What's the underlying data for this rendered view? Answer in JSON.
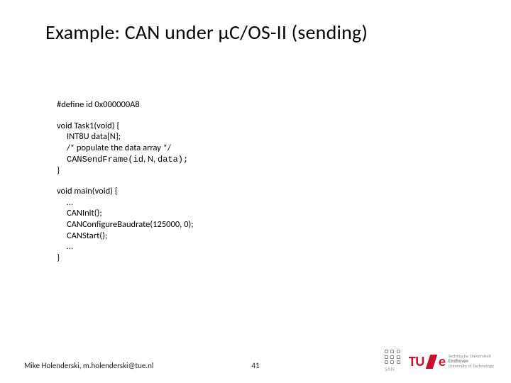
{
  "title": "Example: CAN under μC/OS-II (sending)",
  "code": {
    "define": "#define id 0x000000A8",
    "task": {
      "l1": "void Task1(void) {",
      "l2": "INT8U data[N];",
      "l3": "/* populate the data array */",
      "l4a": "CANSendFrame(id",
      "l4b": ", N, ",
      "l4c": "data);",
      "l5": "}"
    },
    "main": {
      "l1": "void main(void) {",
      "l2": "…",
      "l3": "CANInit();",
      "l4": "CANConfigureBaudrate(125000, 0);",
      "l5": "CANStart();",
      "l6": "…",
      "l7": "}"
    }
  },
  "footer": {
    "author": "Mike Holenderski, m.holenderski@tue.nl",
    "page": "41"
  },
  "logos": {
    "san": "SAN",
    "tue_mark": "TU",
    "tue_text1": "Technische Universiteit",
    "tue_text2": "Eindhoven",
    "tue_text3": "University of Technology"
  }
}
